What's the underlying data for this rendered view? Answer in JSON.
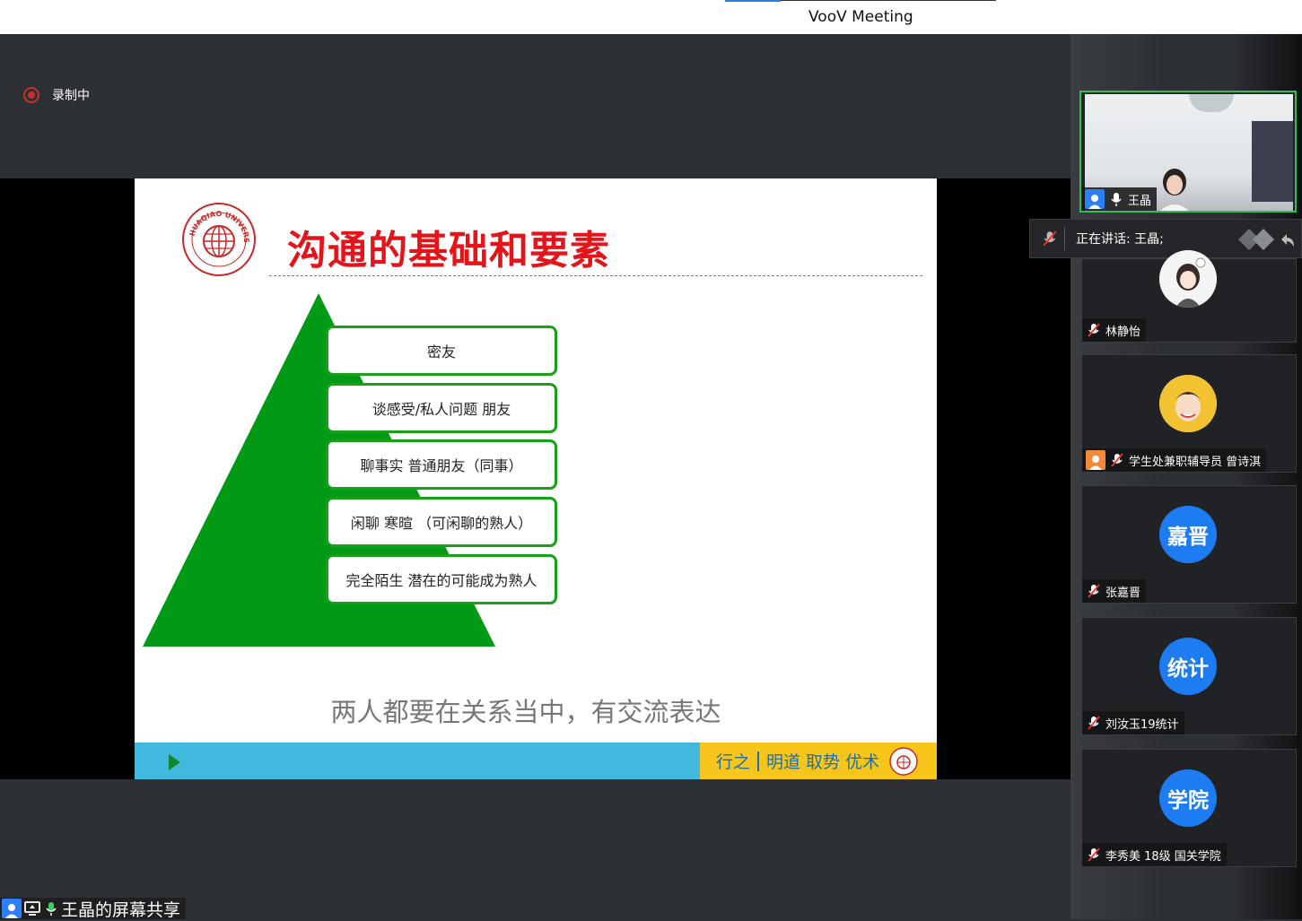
{
  "window": {
    "title": "VooV Meeting"
  },
  "recording": {
    "label": "录制中"
  },
  "slide": {
    "title": "沟通的基础和要素",
    "logo_text": "HUAQIAO UNIVERSITY",
    "tiers": [
      "密友",
      "谈感受/私人问题 朋友",
      "聊事实 普通朋友（同事）",
      "闲聊 寒暄 （可闲聊的熟人）",
      "完全陌生 潜在的可能成为熟人"
    ],
    "caption": "两人都要在关系当中，有交流表达",
    "footer_left": "行之",
    "footer_right": "明道 取势 优术"
  },
  "speaking": {
    "label": "正在讲话: 王晶;"
  },
  "participants": [
    {
      "name": "王晶"
    },
    {
      "name": "林静怡"
    },
    {
      "name": "学生处兼职辅导员 曾诗淇"
    },
    {
      "name": "张嘉晋",
      "avatar_text": "嘉晋"
    },
    {
      "name": "刘汝玉19统计",
      "avatar_text": "统计"
    },
    {
      "name": "李秀美 18级 国关学院",
      "avatar_text": "学院"
    }
  ],
  "screen_share": {
    "label": "王晶的屏幕共享"
  },
  "colors": {
    "accent_blue": "#1d7cf2",
    "active_border": "#2fbf5a",
    "pyramid_green": "#009a17",
    "title_red": "#e4141a"
  }
}
